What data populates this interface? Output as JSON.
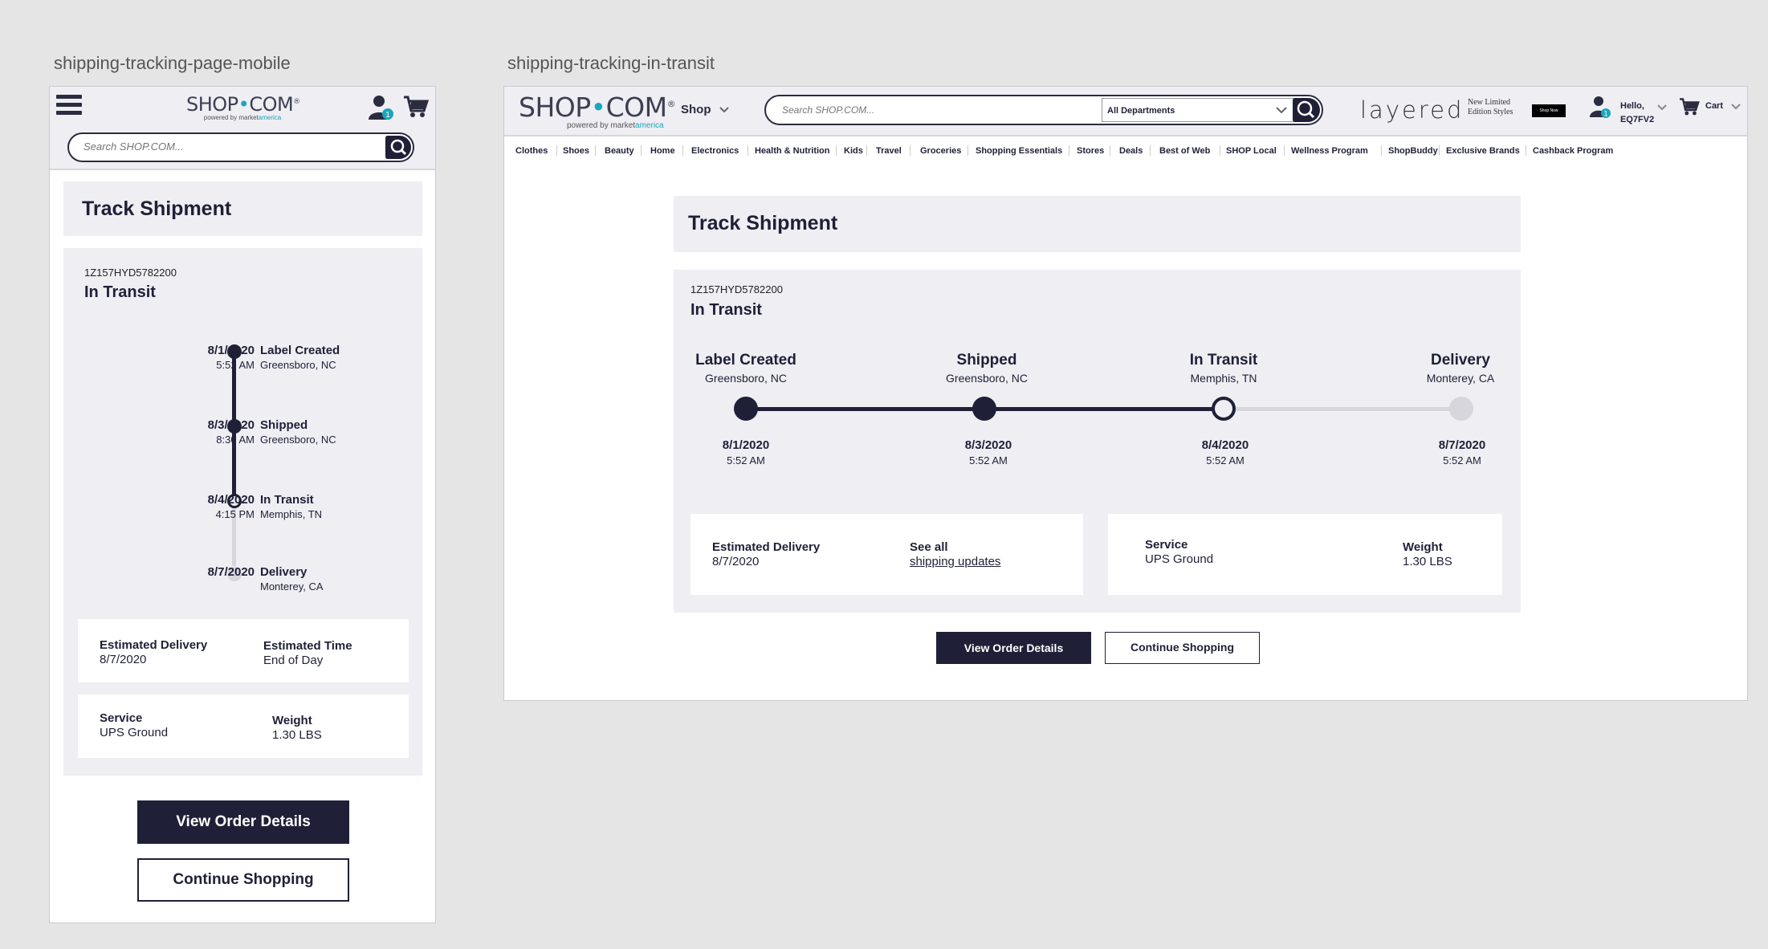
{
  "frames": {
    "mobile_label": "shipping-tracking-page-mobile",
    "desktop_label": "shipping-tracking-in-transit"
  },
  "brand": {
    "logo_left": "SHOP",
    "logo_dot": "•",
    "logo_right": "COM",
    "logo_reg": "®",
    "powered_by": "powered by market",
    "powered_brand": "america",
    "accent": "#1ba6b9",
    "navy": "#1f2037"
  },
  "search": {
    "placeholder": "Search SHOP.COM..."
  },
  "header": {
    "shop_label": "Shop",
    "department": "All Departments",
    "promo_brand": "layered",
    "promo_tag_line1": "New  Limited",
    "promo_tag_line2": "Edition Styles",
    "promo_button": "Shop Now",
    "user_badge": "1",
    "hello": "Hello,",
    "user_code": "EQ7FV2",
    "cart_label": "Cart"
  },
  "nav": [
    "Clothes",
    "Shoes",
    "Beauty",
    "Home",
    "Electronics",
    "Health & Nutrition",
    "Kids",
    "Travel",
    "Groceries",
    "Shopping Essentials",
    "Stores",
    "Deals",
    "Best of Web",
    "SHOP Local",
    "Wellness Program",
    "ShopBuddy",
    "Exclusive Brands",
    "Cashback Program"
  ],
  "tracking": {
    "page_title": "Track Shipment",
    "tracking_number": "1Z157HYD5782200",
    "status": "In Transit",
    "events": [
      {
        "event": "Label Created",
        "location": "Greensboro, NC",
        "date": "8/1/2020",
        "mobile_time": "5:52 AM",
        "desktop_time": "5:52 AM",
        "state": "complete"
      },
      {
        "event": "Shipped",
        "location": "Greensboro, NC",
        "date": "8/3/2020",
        "mobile_time": "8:30 AM",
        "desktop_time": "5:52 AM",
        "state": "complete"
      },
      {
        "event": "In Transit",
        "location": "Memphis, TN",
        "date": "8/4/2020",
        "mobile_time": "4:15 PM",
        "desktop_time": "5:52 AM",
        "state": "current"
      },
      {
        "event": "Delivery",
        "location": "Monterey, CA",
        "date": "8/7/2020",
        "mobile_time": "",
        "desktop_time": "5:52 AM",
        "state": "pending"
      }
    ],
    "estimated_delivery_label": "Estimated Delivery",
    "estimated_delivery_value": "8/7/2020",
    "estimated_time_label": "Estimated Time",
    "estimated_time_value": "End of Day",
    "see_all_label": "See all",
    "see_all_link": "shipping updates",
    "service_label": "Service",
    "service_value": "UPS Ground",
    "weight_label": "Weight",
    "weight_value": "1.30 LBS"
  },
  "actions": {
    "view_order": "View Order Details",
    "continue_shopping": "Continue Shopping"
  }
}
